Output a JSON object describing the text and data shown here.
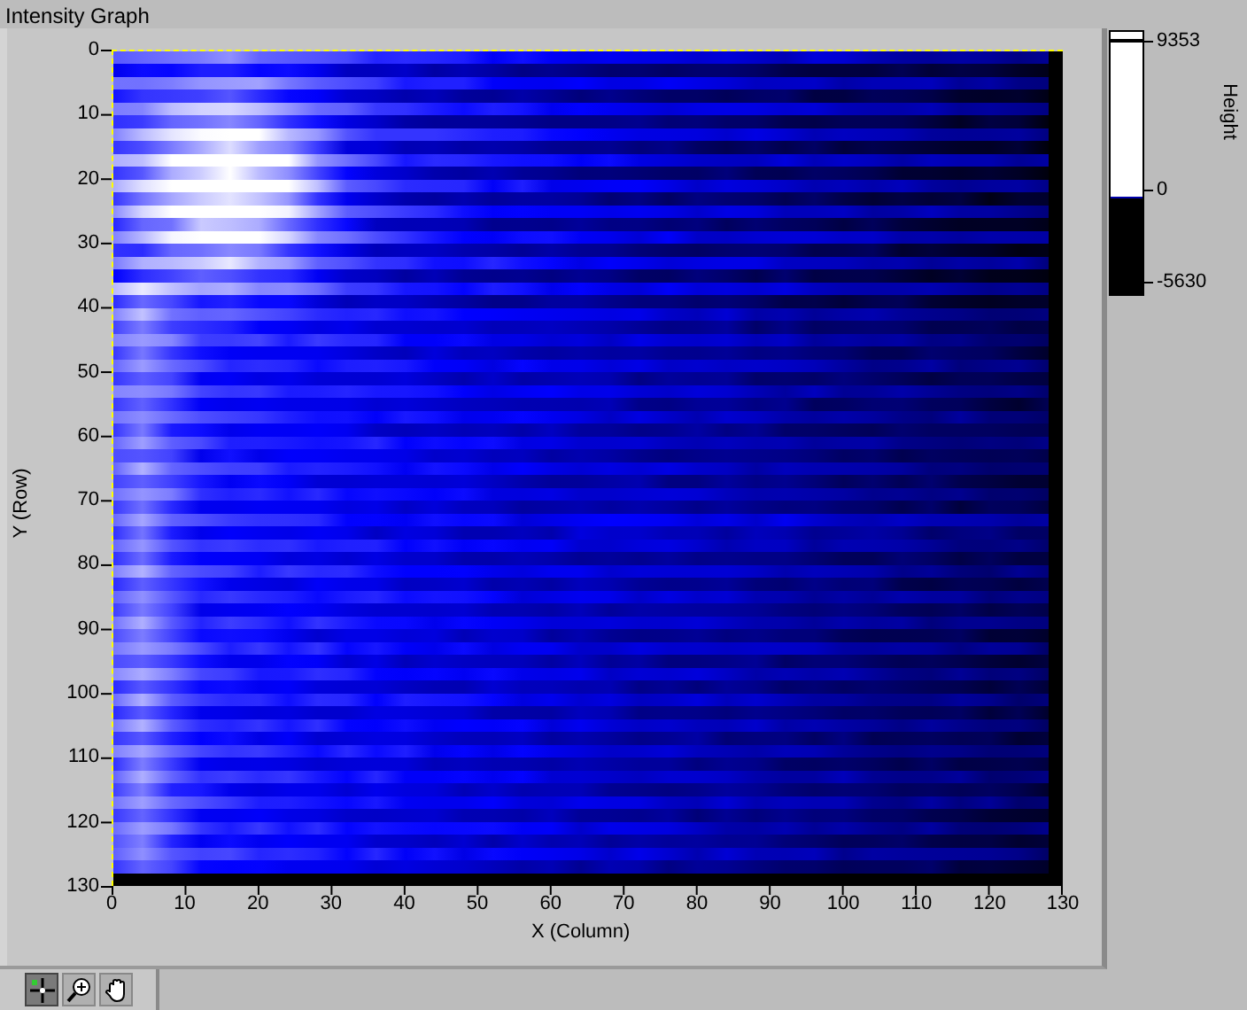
{
  "title": "Intensity Graph",
  "graph": {
    "y_axis": {
      "label": "Y (Row)",
      "ticks": [
        "0",
        "10",
        "20",
        "30",
        "40",
        "50",
        "60",
        "70",
        "80",
        "90",
        "100",
        "110",
        "120",
        "130"
      ]
    },
    "x_axis": {
      "label": "X (Column)",
      "ticks": [
        "0",
        "10",
        "20",
        "30",
        "40",
        "50",
        "60",
        "70",
        "80",
        "90",
        "100",
        "110",
        "120",
        "130"
      ]
    },
    "color_scale": {
      "label": "Height",
      "ticks": [
        "9353",
        "0",
        "-5630"
      ]
    }
  },
  "tools": [
    {
      "kind": "cursor",
      "selected": true
    },
    {
      "kind": "zoom",
      "selected": false
    },
    {
      "kind": "pan",
      "selected": false
    }
  ]
}
